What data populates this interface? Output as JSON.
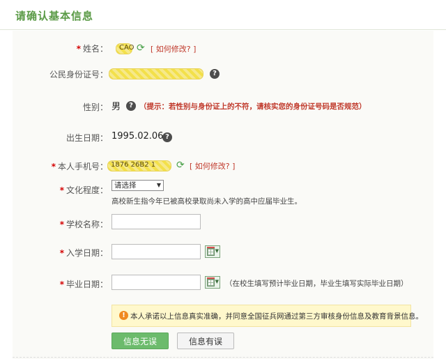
{
  "header": {
    "title": "请确认基本信息"
  },
  "required_mark": "*",
  "form": {
    "name": {
      "label": "姓名：",
      "masked": "CAO",
      "edit_link": "[ 如何修改? ]"
    },
    "id_number": {
      "label": "公民身份证号：",
      "masked": ""
    },
    "gender": {
      "label": "性别：",
      "value": "男",
      "tip": "（提示：若性别与身份证上的不符，请核实您的身份证号码是否规范）"
    },
    "birth_date": {
      "label": "出生日期：",
      "value": "1995.02.06"
    },
    "phone": {
      "label": "本人手机号：",
      "masked": "1876 26B2 1",
      "edit_link": "[ 如何修改? ]"
    },
    "education": {
      "label": "文化程度：",
      "selected": "请选择",
      "note": "高校新生指今年已被高校录取尚未入学的高中应届毕业生。"
    },
    "school": {
      "label": "学校名称：",
      "value": ""
    },
    "enroll_date": {
      "label": "入学日期：",
      "value": ""
    },
    "graduation_date": {
      "label": "毕业日期：",
      "value": "",
      "hint": "（在校生填写预计毕业日期，毕业生填写实际毕业日期）"
    }
  },
  "notice": {
    "text": "本人承诺以上信息真实准确，并同意全国征兵网通过第三方审核身份信息及教育背景信息。"
  },
  "buttons": {
    "confirm": "信息无误",
    "error": "信息有误"
  },
  "icons": {
    "refresh": "refresh-icon",
    "help": "help-icon",
    "calendar": "calendar-icon",
    "warning": "warning-icon"
  },
  "colors": {
    "accent": "#5a9a46",
    "required": "#d40000",
    "tip": "#c0392b",
    "primary_button": "#6cbb6c"
  }
}
